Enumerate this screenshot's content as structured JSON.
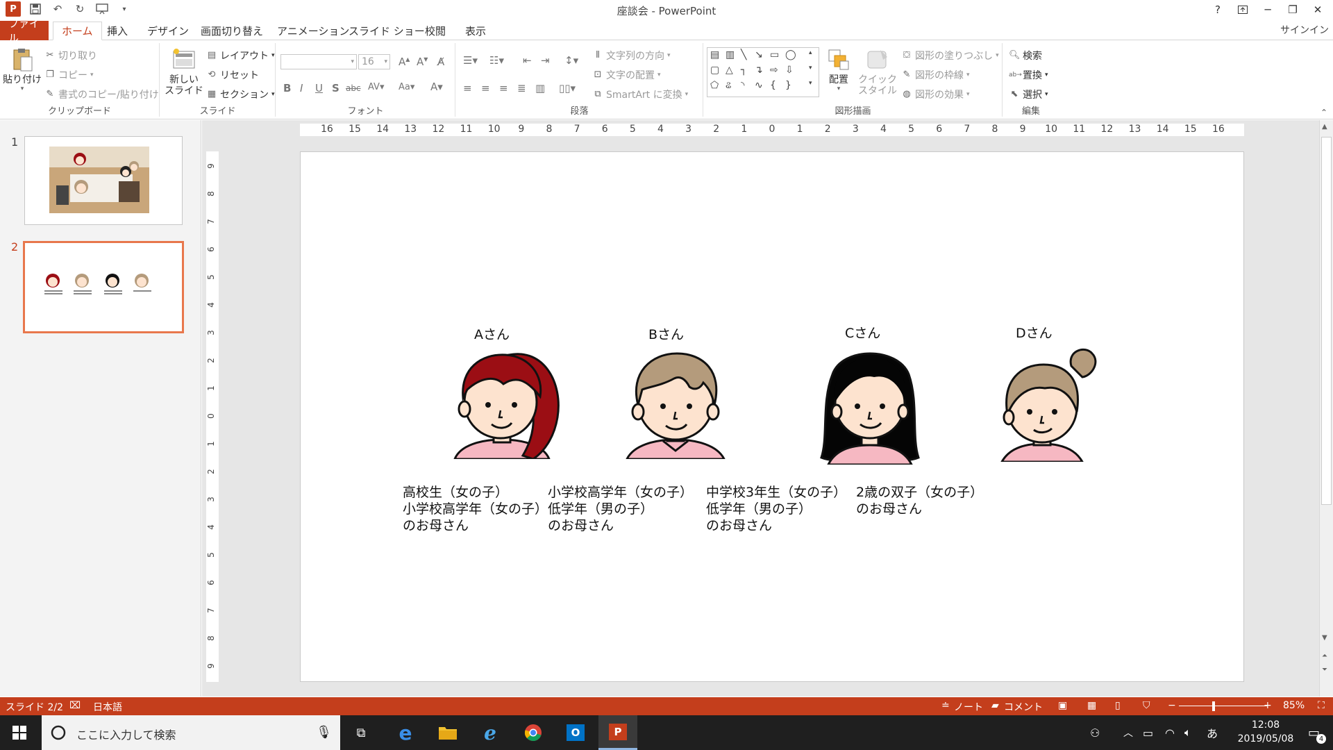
{
  "window": {
    "title": "座談会 - PowerPoint",
    "help": "?",
    "sign_in": "サインイン"
  },
  "tabs": [
    "ファイル",
    "ホーム",
    "挿入",
    "デザイン",
    "画面切り替え",
    "アニメーション",
    "スライド ショー",
    "校閲",
    "表示"
  ],
  "ribbon": {
    "clipboard": {
      "label": "クリップボード",
      "paste": "貼り付け",
      "cut": "切り取り",
      "copy": "コピー",
      "format_painter": "書式のコピー/貼り付け"
    },
    "slides": {
      "label": "スライド",
      "new_slide_1": "新しい",
      "new_slide_2": "スライド",
      "layout": "レイアウト",
      "reset": "リセット",
      "section": "セクション"
    },
    "font": {
      "label": "フォント",
      "size": "16"
    },
    "paragraph": {
      "label": "段落",
      "text_direction": "文字列の方向",
      "align_text": "文字の配置",
      "smartart": "SmartArt に変換"
    },
    "drawing": {
      "label": "図形描画",
      "arrange": "配置",
      "quick_styles_1": "クイック",
      "quick_styles_2": "スタイル",
      "shape_fill": "図形の塗りつぶし",
      "shape_outline": "図形の枠線",
      "shape_effects": "図形の効果"
    },
    "editing": {
      "label": "編集",
      "find": "検索",
      "replace": "置換",
      "select": "選択"
    }
  },
  "thumbnails": [
    {
      "num": "1"
    },
    {
      "num": "2"
    }
  ],
  "ruler": {
    "h_ticks": [
      "16",
      "15",
      "14",
      "13",
      "12",
      "11",
      "10",
      "9",
      "8",
      "7",
      "6",
      "5",
      "4",
      "3",
      "2",
      "1",
      "0",
      "1",
      "2",
      "3",
      "4",
      "5",
      "6",
      "7",
      "8",
      "9",
      "10",
      "11",
      "12",
      "13",
      "14",
      "15",
      "16"
    ],
    "v_ticks": [
      "9",
      "8",
      "7",
      "6",
      "5",
      "4",
      "3",
      "2",
      "1",
      "0",
      "1",
      "2",
      "3",
      "4",
      "5",
      "6",
      "7",
      "8",
      "9"
    ]
  },
  "slide": {
    "people": [
      {
        "name": "Aさん",
        "lines": [
          "高校生（女の子）",
          "小学校高学年（女の子）",
          "のお母さん"
        ],
        "hair": "#9b0e14"
      },
      {
        "name": "Bさん",
        "lines": [
          "小学校高学年（女の子）",
          "低学年（男の子）",
          "のお母さん"
        ],
        "hair": "#b49b7c"
      },
      {
        "name": "Cさん",
        "lines": [
          "中学校3年生（女の子）",
          "低学年（男の子）",
          "のお母さん"
        ],
        "hair": "#050505"
      },
      {
        "name": "Dさん",
        "lines": [
          "2歳の双子（女の子）",
          "のお母さん"
        ],
        "hair": "#b49b7c"
      }
    ]
  },
  "status": {
    "slide": "スライド 2/2",
    "language": "日本語",
    "notes": "ノート",
    "comments": "コメント",
    "zoom": "85%"
  },
  "taskbar": {
    "search_placeholder": "ここに入力して検索",
    "ime": "あ",
    "time": "12:08",
    "date": "2019/05/08",
    "notifications": "4"
  },
  "colors": {
    "accent": "#c43e1c",
    "skin": "#fde3cf",
    "shirt": "#f6b8c2"
  }
}
